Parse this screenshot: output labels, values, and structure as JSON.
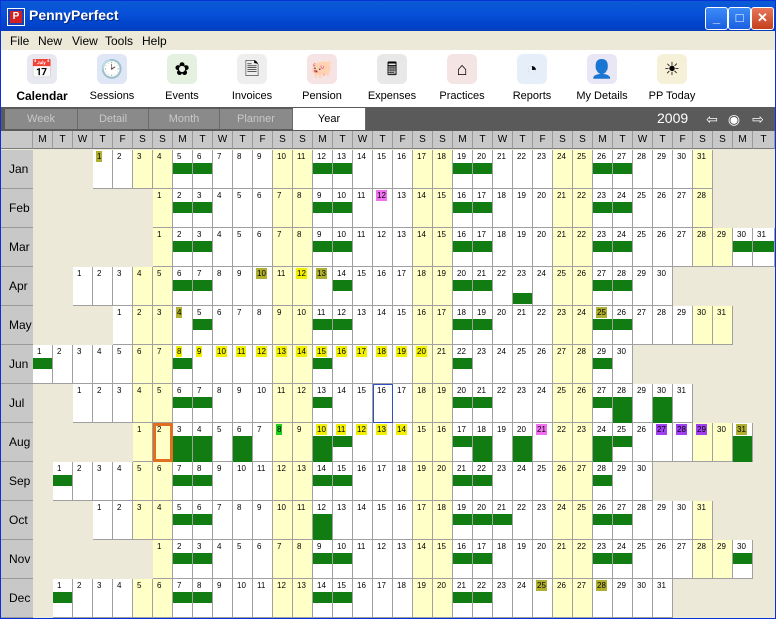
{
  "window": {
    "title": "PennyPerfect",
    "icon_letter": "P",
    "buttons": {
      "minimize": "_",
      "maximize": "□",
      "close": "✕"
    }
  },
  "menu": [
    "File",
    "New",
    "View",
    "Tools",
    "Help"
  ],
  "toolbar": [
    {
      "label": "Calendar",
      "icon": "calendar-icon",
      "glyph": "📅",
      "active": true
    },
    {
      "label": "Sessions",
      "icon": "sessions-clock-icon",
      "glyph": "🕑",
      "active": false
    },
    {
      "label": "Events",
      "icon": "events-icon",
      "glyph": "✿",
      "active": false
    },
    {
      "label": "Invoices",
      "icon": "invoices-icon",
      "glyph": "🗎",
      "active": false
    },
    {
      "label": "Pension",
      "icon": "pension-pig-icon",
      "glyph": "🐖",
      "active": false
    },
    {
      "label": "Expenses",
      "icon": "expenses-till-icon",
      "glyph": "🖩",
      "active": false
    },
    {
      "label": "Practices",
      "icon": "practices-house-icon",
      "glyph": "⌂",
      "active": false
    },
    {
      "label": "Reports",
      "icon": "reports-chart-icon",
      "glyph": "◔",
      "active": false
    },
    {
      "label": "My Details",
      "icon": "my-details-person-icon",
      "glyph": "👤",
      "active": false
    },
    {
      "label": "PP Today",
      "icon": "pp-today-icon",
      "glyph": "☀",
      "active": false
    }
  ],
  "tabs": [
    {
      "label": "Week",
      "selected": false
    },
    {
      "label": "Detail",
      "selected": false
    },
    {
      "label": "Month",
      "selected": false
    },
    {
      "label": "Planner",
      "selected": false
    },
    {
      "label": "Year",
      "selected": true
    }
  ],
  "year": "2009",
  "nav": {
    "prev": "prev-arrow-icon",
    "today": "today-circle-icon",
    "next": "next-arrow-icon"
  },
  "day_headers": [
    "M",
    "T",
    "W",
    "T",
    "F",
    "S",
    "S",
    "M",
    "T",
    "W",
    "T",
    "F",
    "S",
    "S",
    "M",
    "T",
    "W",
    "T",
    "F",
    "S",
    "S",
    "M",
    "T",
    "W",
    "T",
    "F",
    "S",
    "S",
    "M",
    "T",
    "W",
    "T",
    "F",
    "S",
    "S",
    "M",
    "T"
  ],
  "months": [
    {
      "name": "Jan",
      "start": 3,
      "days": 31,
      "bars": [
        5,
        6,
        12,
        13,
        19,
        20,
        26,
        27
      ],
      "tall": [],
      "marks": {
        "1": "#b0b030"
      }
    },
    {
      "name": "Feb",
      "start": 6,
      "days": 28,
      "bars": [
        2,
        3,
        9,
        10,
        16,
        17,
        23,
        24
      ],
      "tall": [],
      "marks": {
        "12": "#f070f0"
      }
    },
    {
      "name": "Mar",
      "start": 6,
      "days": 31,
      "bars": [
        2,
        3,
        9,
        10,
        16,
        17,
        23,
        24,
        30,
        31
      ],
      "tall": [],
      "marks": {}
    },
    {
      "name": "Apr",
      "start": 2,
      "days": 30,
      "bars": [
        6,
        7,
        14,
        20,
        21,
        27,
        28
      ],
      "tall": [],
      "marks": {
        "10": "#b0b030",
        "12": "#f0f000",
        "13": "#b0b030"
      },
      "extra": [
        {
          "d": 23,
          "bottom": true
        }
      ]
    },
    {
      "name": "May",
      "start": 4,
      "days": 31,
      "bars": [
        5,
        11,
        12,
        18,
        19,
        25,
        26
      ],
      "tall": [],
      "marks": {
        "4": "#b0b030",
        "25": "#b0b030"
      }
    },
    {
      "name": "Jun",
      "start": 0,
      "days": 30,
      "bars": [
        1,
        8,
        15,
        22,
        29
      ],
      "tall": [],
      "marks": {
        "8": "#f0f000",
        "9": "#f0f000",
        "10": "#f0f000",
        "11": "#f0f000",
        "12": "#f0f000",
        "13": "#f0f000",
        "14": "#f0f000",
        "15": "#f0f000",
        "16": "#f0f000",
        "17": "#f0f000",
        "18": "#f0f000",
        "19": "#f0f000",
        "20": "#f0f000"
      }
    },
    {
      "name": "Jul",
      "start": 2,
      "days": 31,
      "bars": [
        6,
        7,
        13,
        20,
        21,
        27
      ],
      "tall": [
        28,
        30
      ],
      "marks": {},
      "today": 16
    },
    {
      "name": "Aug",
      "start": 5,
      "days": 31,
      "bars": [
        11,
        17,
        25
      ],
      "tall": [
        3,
        4,
        6,
        10,
        18,
        20,
        24,
        31
      ],
      "marks": {
        "8": "#20d020",
        "10": "#f0f000",
        "11": "#f0f000",
        "12": "#f0f000",
        "13": "#f0f000",
        "14": "#f0f000",
        "21": "#f070f0",
        "27": "#a040f0",
        "28": "#a040f0",
        "29": "#a040f0",
        "31": "#b0b030"
      },
      "green8": true,
      "highlight": 2
    },
    {
      "name": "Sep",
      "start": 1,
      "days": 30,
      "bars": [
        1,
        7,
        8,
        14,
        15,
        21,
        22,
        28
      ],
      "tall": [],
      "marks": {}
    },
    {
      "name": "Oct",
      "start": 3,
      "days": 31,
      "bars": [
        5,
        6,
        12,
        19,
        20,
        21,
        26,
        27
      ],
      "tall": [
        12
      ],
      "marks": {}
    },
    {
      "name": "Nov",
      "start": 6,
      "days": 30,
      "bars": [
        2,
        3,
        9,
        10,
        16,
        17,
        23,
        24,
        30
      ],
      "tall": [],
      "marks": {}
    },
    {
      "name": "Dec",
      "start": 1,
      "days": 31,
      "bars": [
        1,
        7,
        8,
        14,
        15,
        21,
        22
      ],
      "tall": [],
      "marks": {
        "25": "#b0b030",
        "28": "#b0b030"
      }
    }
  ]
}
